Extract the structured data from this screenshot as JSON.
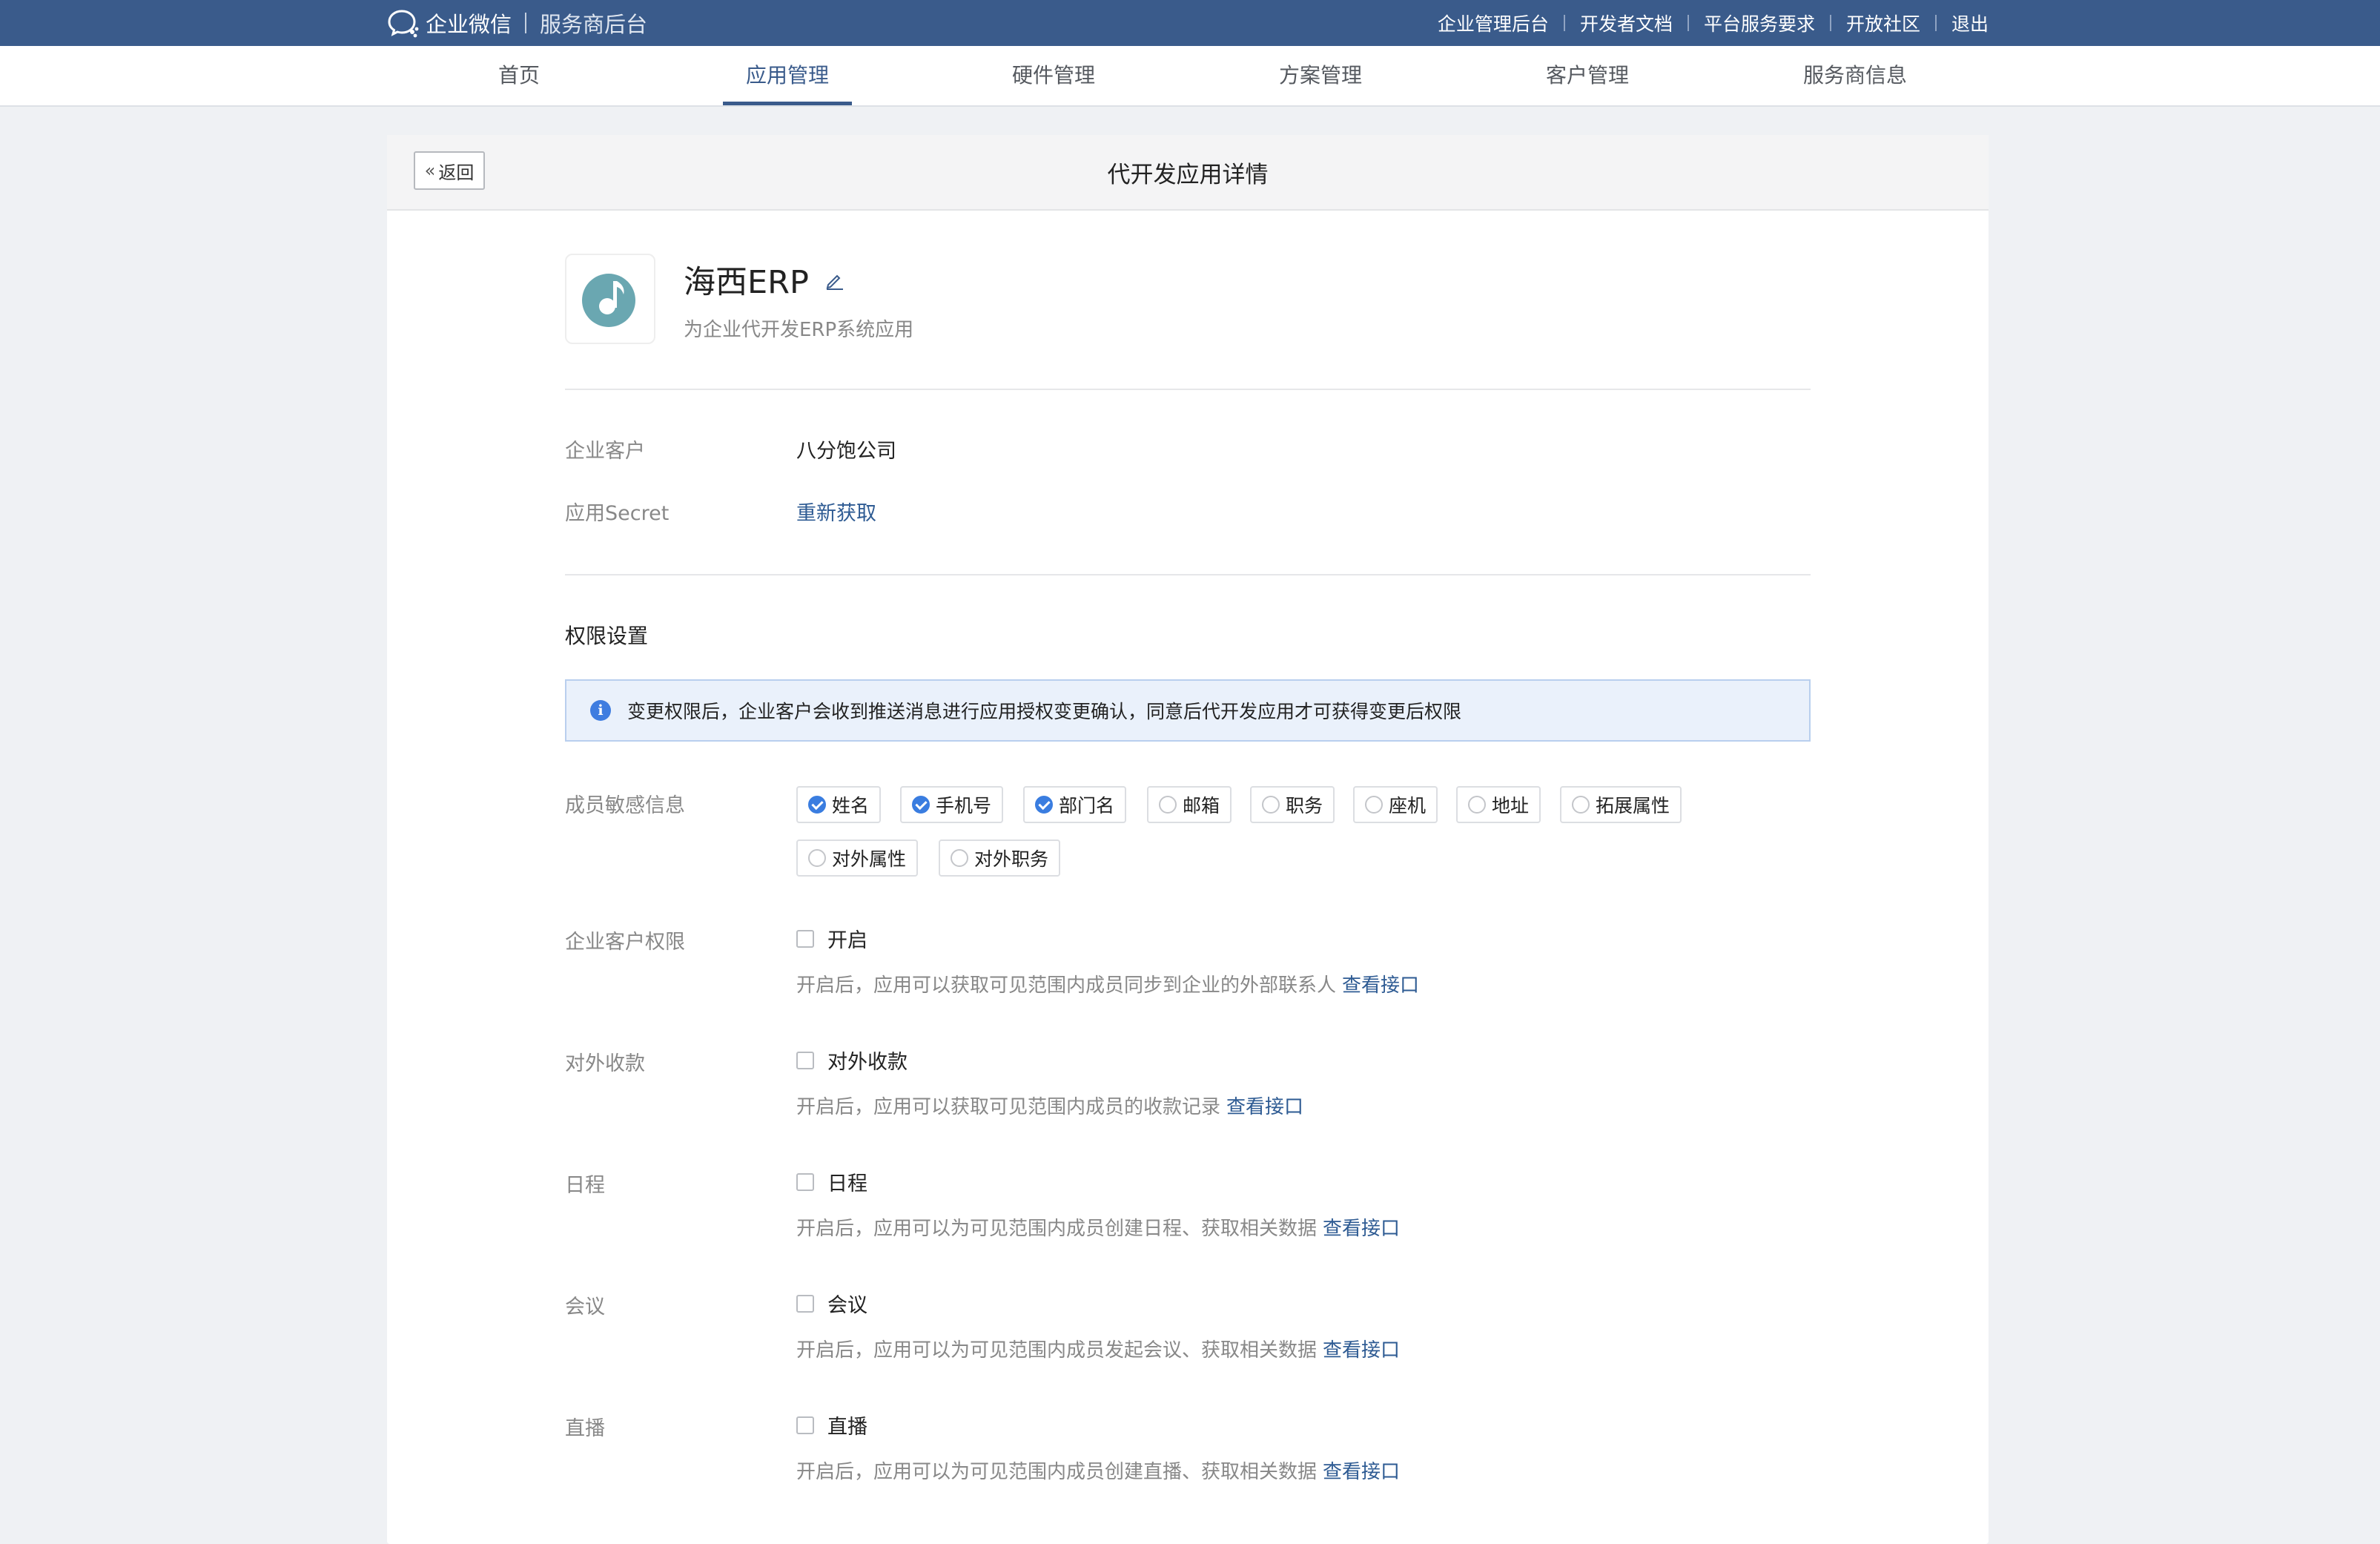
{
  "header": {
    "brand": "企业微信",
    "subtitle": "服务商后台",
    "links": [
      "企业管理后台",
      "开发者文档",
      "平台服务要求",
      "开放社区",
      "退出"
    ]
  },
  "nav": {
    "tabs": [
      "首页",
      "应用管理",
      "硬件管理",
      "方案管理",
      "客户管理",
      "服务商信息"
    ],
    "active": "应用管理"
  },
  "page": {
    "back_label": "返回",
    "title": "代开发应用详情"
  },
  "app": {
    "name": "海西ERP",
    "description": "为企业代开发ERP系统应用",
    "icon_color": "#6aa7b1"
  },
  "info": {
    "customer_label": "企业客户",
    "customer_value": "八分饱公司",
    "secret_label": "应用Secret",
    "secret_action": "重新获取"
  },
  "permissions": {
    "section_title": "权限设置",
    "notice": "变更权限后，企业客户会收到推送消息进行应用授权变更确认，同意后代开发应用才可获得变更后权限",
    "member_label": "成员敏感信息",
    "member_fields": [
      {
        "label": "姓名",
        "checked": true
      },
      {
        "label": "手机号",
        "checked": true
      },
      {
        "label": "部门名",
        "checked": true
      },
      {
        "label": "邮箱",
        "checked": false
      },
      {
        "label": "职务",
        "checked": false
      },
      {
        "label": "座机",
        "checked": false
      },
      {
        "label": "地址",
        "checked": false
      },
      {
        "label": "拓展属性",
        "checked": false
      },
      {
        "label": "对外属性",
        "checked": false
      },
      {
        "label": "对外职务",
        "checked": false
      }
    ],
    "items": [
      {
        "label": "企业客户权限",
        "option": "开启",
        "checked": false,
        "hint": "开启后，应用可以获取可见范围内成员同步到企业的外部联系人",
        "link": "查看接口"
      },
      {
        "label": "对外收款",
        "option": "对外收款",
        "checked": false,
        "hint": "开启后，应用可以获取可见范围内成员的收款记录",
        "link": "查看接口"
      },
      {
        "label": "日程",
        "option": "日程",
        "checked": false,
        "hint": "开启后，应用可以为可见范围内成员创建日程、获取相关数据",
        "link": "查看接口"
      },
      {
        "label": "会议",
        "option": "会议",
        "checked": false,
        "hint": "开启后，应用可以为可见范围内成员发起会议、获取相关数据",
        "link": "查看接口"
      },
      {
        "label": "直播",
        "option": "直播",
        "checked": false,
        "hint": "开启后，应用可以为可见范围内成员创建直播、获取相关数据",
        "link": "查看接口"
      }
    ]
  },
  "colors": {
    "topbar": "#3a5b8b",
    "accent": "#3a7de0",
    "link": "#2e5b93"
  }
}
